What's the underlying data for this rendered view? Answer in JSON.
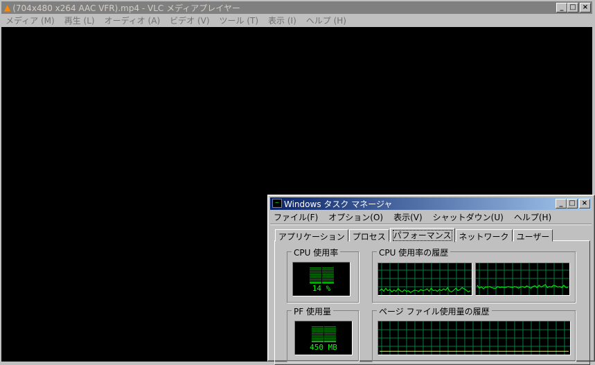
{
  "vlc": {
    "title": "(704x480 x264 AAC VFR).mp4 - VLC メディアプレイヤー",
    "menu": [
      "メディア (M)",
      "再生 (L)",
      "オーディオ (A)",
      "ビデオ (V)",
      "ツール (T)",
      "表示 (I)",
      "ヘルプ (H)"
    ]
  },
  "taskmgr": {
    "title": "Windows タスク マネージャ",
    "menu": [
      "ファイル(F)",
      "オプション(O)",
      "表示(V)",
      "シャットダウン(U)",
      "ヘルプ(H)"
    ],
    "tabs": [
      "アプリケーション",
      "プロセス",
      "パフォーマンス",
      "ネットワーク",
      "ユーザー"
    ],
    "active_tab": 2,
    "cpu_label": "CPU 使用率",
    "cpu_value": "14 %",
    "cpu_percent": 14,
    "cpu_history_label": "CPU 使用率の履歴",
    "pf_label": "PF 使用量",
    "pf_value": "450 MB",
    "pf_fraction": 0.1,
    "pf_history_label": "ページ ファイル使用量の履歴"
  },
  "chart_data": {
    "type": "line",
    "series": [
      {
        "name": "cpu0",
        "values": [
          12,
          18,
          10,
          20,
          12,
          16,
          8,
          14,
          10,
          19,
          12,
          8,
          15,
          10,
          12,
          6,
          10,
          14,
          12,
          10,
          16,
          12,
          14,
          18,
          10,
          20,
          12,
          14,
          10,
          16,
          12,
          18,
          14,
          22,
          10,
          8,
          14,
          20,
          12,
          16,
          22,
          18,
          14,
          8,
          12
        ]
      },
      {
        "name": "cpu1",
        "values": [
          30,
          20,
          25,
          18,
          24,
          24,
          26,
          22,
          20,
          20,
          26,
          22,
          24,
          22,
          23,
          26,
          24,
          22,
          26,
          24,
          20,
          24,
          26,
          22,
          28,
          24,
          20,
          26,
          28,
          22,
          30,
          24,
          28,
          32,
          22,
          26,
          24,
          30,
          28,
          24,
          26,
          22,
          30,
          22,
          22
        ]
      },
      {
        "name": "pf",
        "values": [
          8,
          8,
          8,
          8,
          8,
          8,
          8,
          8,
          8,
          8
        ]
      }
    ],
    "ylim": [
      0,
      100
    ],
    "colors": {
      "cpu": "#00ff00",
      "pf": "#ffff00",
      "grid": "#008040"
    }
  }
}
